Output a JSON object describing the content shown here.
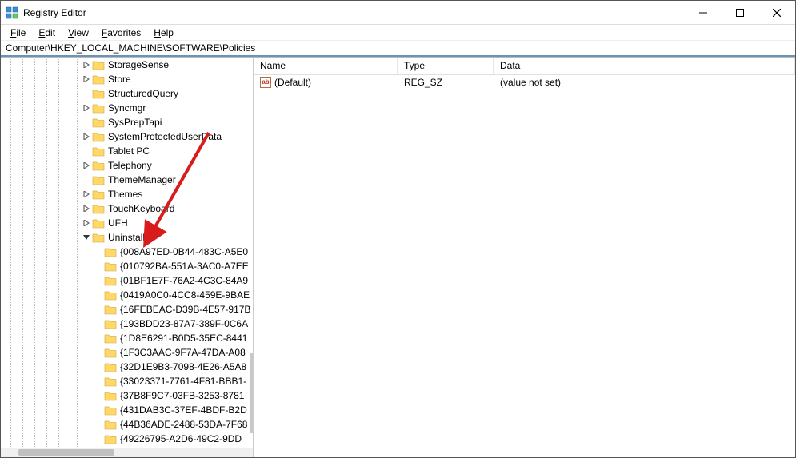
{
  "window": {
    "title": "Registry Editor"
  },
  "menu": {
    "file": "File",
    "edit": "Edit",
    "view": "View",
    "favorites": "Favorites",
    "help": "Help"
  },
  "address": "Computer\\HKEY_LOCAL_MACHINE\\SOFTWARE\\Policies",
  "tree": {
    "items": [
      {
        "label": "StorageSense",
        "expander": ">",
        "indent": 6
      },
      {
        "label": "Store",
        "expander": ">",
        "indent": 6
      },
      {
        "label": "StructuredQuery",
        "expander": "",
        "indent": 6
      },
      {
        "label": "Syncmgr",
        "expander": ">",
        "indent": 6
      },
      {
        "label": "SysPrepTapi",
        "expander": "",
        "indent": 6
      },
      {
        "label": "SystemProtectedUserData",
        "expander": ">",
        "indent": 6
      },
      {
        "label": "Tablet PC",
        "expander": "",
        "indent": 6
      },
      {
        "label": "Telephony",
        "expander": ">",
        "indent": 6
      },
      {
        "label": "ThemeManager",
        "expander": "",
        "indent": 6
      },
      {
        "label": "Themes",
        "expander": ">",
        "indent": 6
      },
      {
        "label": "TouchKeyboard",
        "expander": ">",
        "indent": 6
      },
      {
        "label": "UFH",
        "expander": ">",
        "indent": 6
      },
      {
        "label": "Uninstall",
        "expander": "v",
        "indent": 6
      },
      {
        "label": "{008A97ED-0B44-483C-A5E0",
        "expander": "",
        "indent": 7
      },
      {
        "label": "{010792BA-551A-3AC0-A7EE",
        "expander": "",
        "indent": 7
      },
      {
        "label": "{01BF1E7F-76A2-4C3C-84A9",
        "expander": "",
        "indent": 7
      },
      {
        "label": "{0419A0C0-4CC8-459E-9BAE",
        "expander": "",
        "indent": 7
      },
      {
        "label": "{16FEBEAC-D39B-4E57-917B",
        "expander": "",
        "indent": 7
      },
      {
        "label": "{193BDD23-87A7-389F-0C6A",
        "expander": "",
        "indent": 7
      },
      {
        "label": "{1D8E6291-B0D5-35EC-8441",
        "expander": "",
        "indent": 7
      },
      {
        "label": "{1F3C3AAC-9F7A-47DA-A08",
        "expander": "",
        "indent": 7
      },
      {
        "label": "{32D1E9B3-7098-4E26-A5A8",
        "expander": "",
        "indent": 7
      },
      {
        "label": "{33023371-7761-4F81-BBB1-",
        "expander": "",
        "indent": 7
      },
      {
        "label": "{37B8F9C7-03FB-3253-8781",
        "expander": "",
        "indent": 7
      },
      {
        "label": "{431DAB3C-37EF-4BDF-B2D",
        "expander": "",
        "indent": 7
      },
      {
        "label": "{44B36ADE-2488-53DA-7F68",
        "expander": "",
        "indent": 7
      },
      {
        "label": "{49226795-A2D6-49C2-9DD",
        "expander": "",
        "indent": 7
      }
    ]
  },
  "values": {
    "header": {
      "name": "Name",
      "type": "Type",
      "data": "Data"
    },
    "rows": [
      {
        "name": "(Default)",
        "type": "REG_SZ",
        "data": "(value not set)"
      }
    ]
  }
}
